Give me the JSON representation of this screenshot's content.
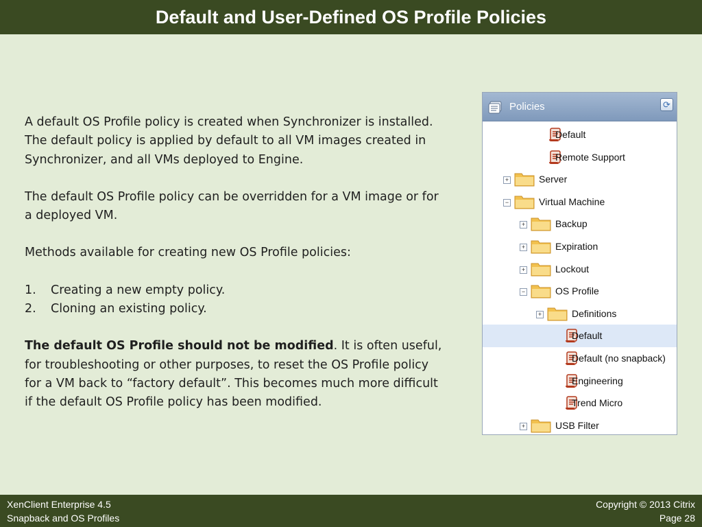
{
  "title": "Default and User-Defined OS Profile Policies",
  "body": {
    "p1": "A default OS Profile policy is created when Synchronizer is installed.  The default policy is applied by default to all VM images created in Synchronizer, and all VMs deployed to Engine.",
    "p2": "The default OS Profile policy can be overridden for a VM image or for a deployed VM.",
    "p3": "Methods available for creating new OS Profile policies:",
    "list": [
      {
        "num": "1.",
        "text": "Creating a new empty policy."
      },
      {
        "num": "2.",
        "text": "Cloning an existing policy."
      }
    ],
    "p4_bold": "The default OS Profile should not be modified",
    "p4_rest": ".  It is often useful, for troubleshooting or other purposes, to reset the OS Profile policy for a VM back to “factory default”.  This becomes much more difficult if the default OS Profile policy has been modified."
  },
  "policies_panel": {
    "header": "Policies",
    "refresh_icon": "refresh-icon",
    "colors": {
      "folder": "#f2c14e",
      "policy": "#b33a1e",
      "selected": "#dde8f7"
    },
    "tree": [
      {
        "label": "Default",
        "type": "policy",
        "depth": 2
      },
      {
        "label": "Remote Support",
        "type": "policy",
        "depth": 2
      },
      {
        "label": "Server",
        "type": "folder",
        "depth": 1,
        "expander": "+"
      },
      {
        "label": "Virtual Machine",
        "type": "folder",
        "depth": 1,
        "expander": "−"
      },
      {
        "label": "Backup",
        "type": "folder",
        "depth": 2,
        "expander": "+"
      },
      {
        "label": "Expiration",
        "type": "folder",
        "depth": 2,
        "expander": "+"
      },
      {
        "label": "Lockout",
        "type": "folder",
        "depth": 2,
        "expander": "+"
      },
      {
        "label": "OS Profile",
        "type": "folder",
        "depth": 2,
        "expander": "−"
      },
      {
        "label": "Definitions",
        "type": "folder",
        "depth": 3,
        "expander": "+"
      },
      {
        "label": "Default",
        "type": "policy",
        "depth": 3,
        "selected": true
      },
      {
        "label": "Default (no snapback)",
        "type": "policy",
        "depth": 3
      },
      {
        "label": "Engineering",
        "type": "policy",
        "depth": 3
      },
      {
        "label": "Trend Micro",
        "type": "policy",
        "depth": 3
      },
      {
        "label": "USB Filter",
        "type": "folder",
        "depth": 2,
        "expander": "+"
      }
    ]
  },
  "footer": {
    "left1": "XenClient Enterprise 4.5",
    "left2": "Snapback and OS Profiles",
    "right1": "Copyright © 2013 Citrix",
    "right2": "Page 28"
  }
}
